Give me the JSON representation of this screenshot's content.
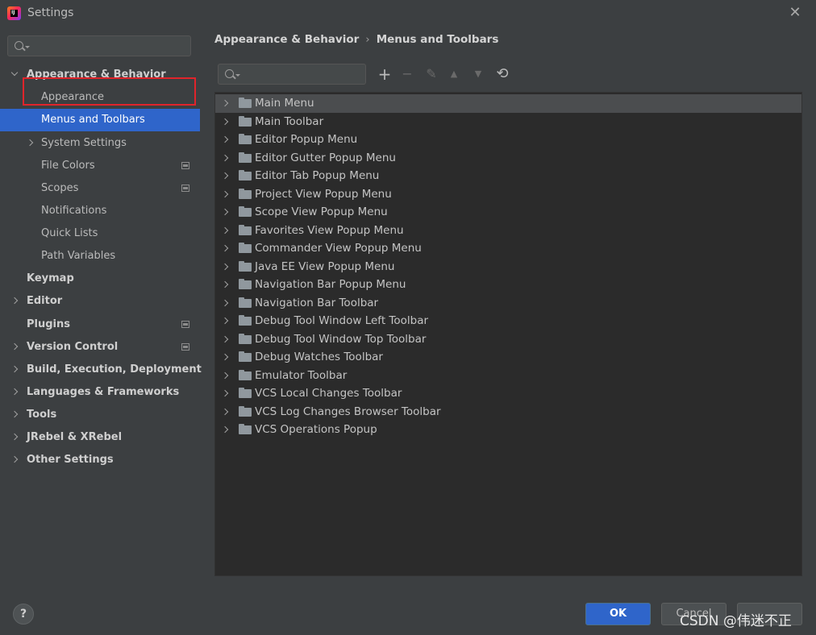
{
  "window": {
    "title": "Settings",
    "close_glyph": "✕"
  },
  "left_search": {
    "placeholder": ""
  },
  "sidebar": {
    "items": [
      {
        "label": "Appearance & Behavior",
        "bold": true,
        "expanded": true
      },
      {
        "label": "Appearance"
      },
      {
        "label": "Menus and Toolbars",
        "selected": true
      },
      {
        "label": "System Settings"
      },
      {
        "label": "File Colors"
      },
      {
        "label": "Scopes"
      },
      {
        "label": "Notifications"
      },
      {
        "label": "Quick Lists"
      },
      {
        "label": "Path Variables"
      },
      {
        "label": "Keymap",
        "bold": true
      },
      {
        "label": "Editor",
        "bold": true
      },
      {
        "label": "Plugins",
        "bold": true
      },
      {
        "label": "Version Control",
        "bold": true
      },
      {
        "label": "Build, Execution, Deployment",
        "bold": true
      },
      {
        "label": "Languages & Frameworks",
        "bold": true
      },
      {
        "label": "Tools",
        "bold": true
      },
      {
        "label": "JRebel & XRebel",
        "bold": true
      },
      {
        "label": "Other Settings",
        "bold": true
      }
    ]
  },
  "breadcrumb": {
    "parent": "Appearance & Behavior",
    "separator": "›",
    "current": "Menus and Toolbars"
  },
  "right_search": {
    "placeholder": ""
  },
  "toolbar": {
    "add": "+",
    "remove": "−",
    "edit": "✎",
    "move_up": "▲",
    "move_down": "▼",
    "restore": "⟲"
  },
  "menu_tree": {
    "rows": [
      "Main Menu",
      "Main Toolbar",
      "Editor Popup Menu",
      "Editor Gutter Popup Menu",
      "Editor Tab Popup Menu",
      "Project View Popup Menu",
      "Scope View Popup Menu",
      "Favorites View Popup Menu",
      "Commander View Popup Menu",
      "Java EE View Popup Menu",
      "Navigation Bar Popup Menu",
      "Navigation Bar Toolbar",
      "Debug Tool Window Left Toolbar",
      "Debug Tool Window Top Toolbar",
      "Debug Watches Toolbar",
      "Emulator Toolbar",
      "VCS Local Changes Toolbar",
      "VCS Log Changes Browser Toolbar",
      "VCS Operations Popup"
    ]
  },
  "footer": {
    "help": "?",
    "ok": "OK",
    "cancel": "Cancel",
    "apply": ""
  },
  "watermark": "CSDN @伟迷不正",
  "colors": {
    "selection": "#2f65ca",
    "highlight_box": "#e0242b",
    "panel_bg": "#2b2b2b",
    "window_bg": "#3c3f41"
  }
}
